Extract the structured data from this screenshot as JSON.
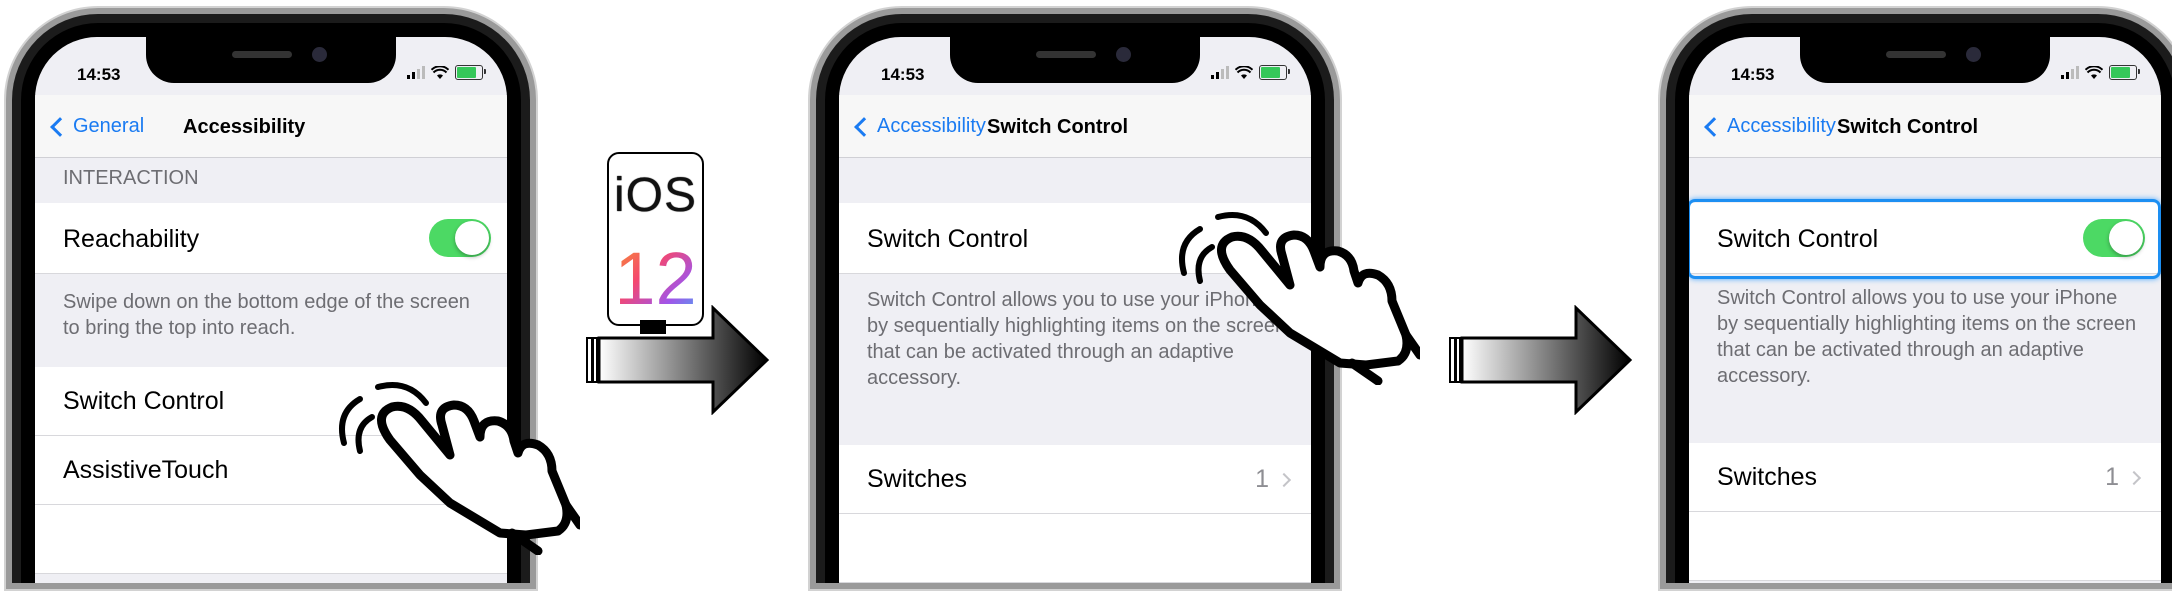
{
  "status": {
    "time": "14:53"
  },
  "panel1": {
    "nav": {
      "back_label": "General",
      "title": "Accessibility"
    },
    "section_header": "INTERACTION",
    "rows": [
      {
        "label": "Reachability",
        "toggle_on": true
      },
      {
        "label": "Switch Control"
      },
      {
        "label": "AssistiveTouch"
      }
    ],
    "reachability_footer": "Swipe down on the bottom edge of the screen to bring the top into reach."
  },
  "badge": {
    "os": "iOS",
    "version": "12"
  },
  "panel2": {
    "nav": {
      "back_label": "Accessibility",
      "title": "Switch Control"
    },
    "switch_label": "Switch Control",
    "description": "Switch Control allows you to use your iPhone by sequentially highlighting items on the screen that can be activated through an adaptive accessory.",
    "switches_label": "Switches",
    "switches_count": "1"
  },
  "panel3": {
    "nav": {
      "back_label": "Accessibility",
      "title": "Switch Control"
    },
    "switch_label": "Switch Control",
    "toggle_on": true,
    "description": "Switch Control allows you to use your iPhone by sequentially highlighting items on the screen that can be activated through an adaptive accessory.",
    "switches_label": "Switches",
    "switches_count": "1"
  },
  "colors": {
    "accent": "#1a7bf2",
    "toggle_on": "#4cd964",
    "highlight": "#1d8ff2"
  }
}
